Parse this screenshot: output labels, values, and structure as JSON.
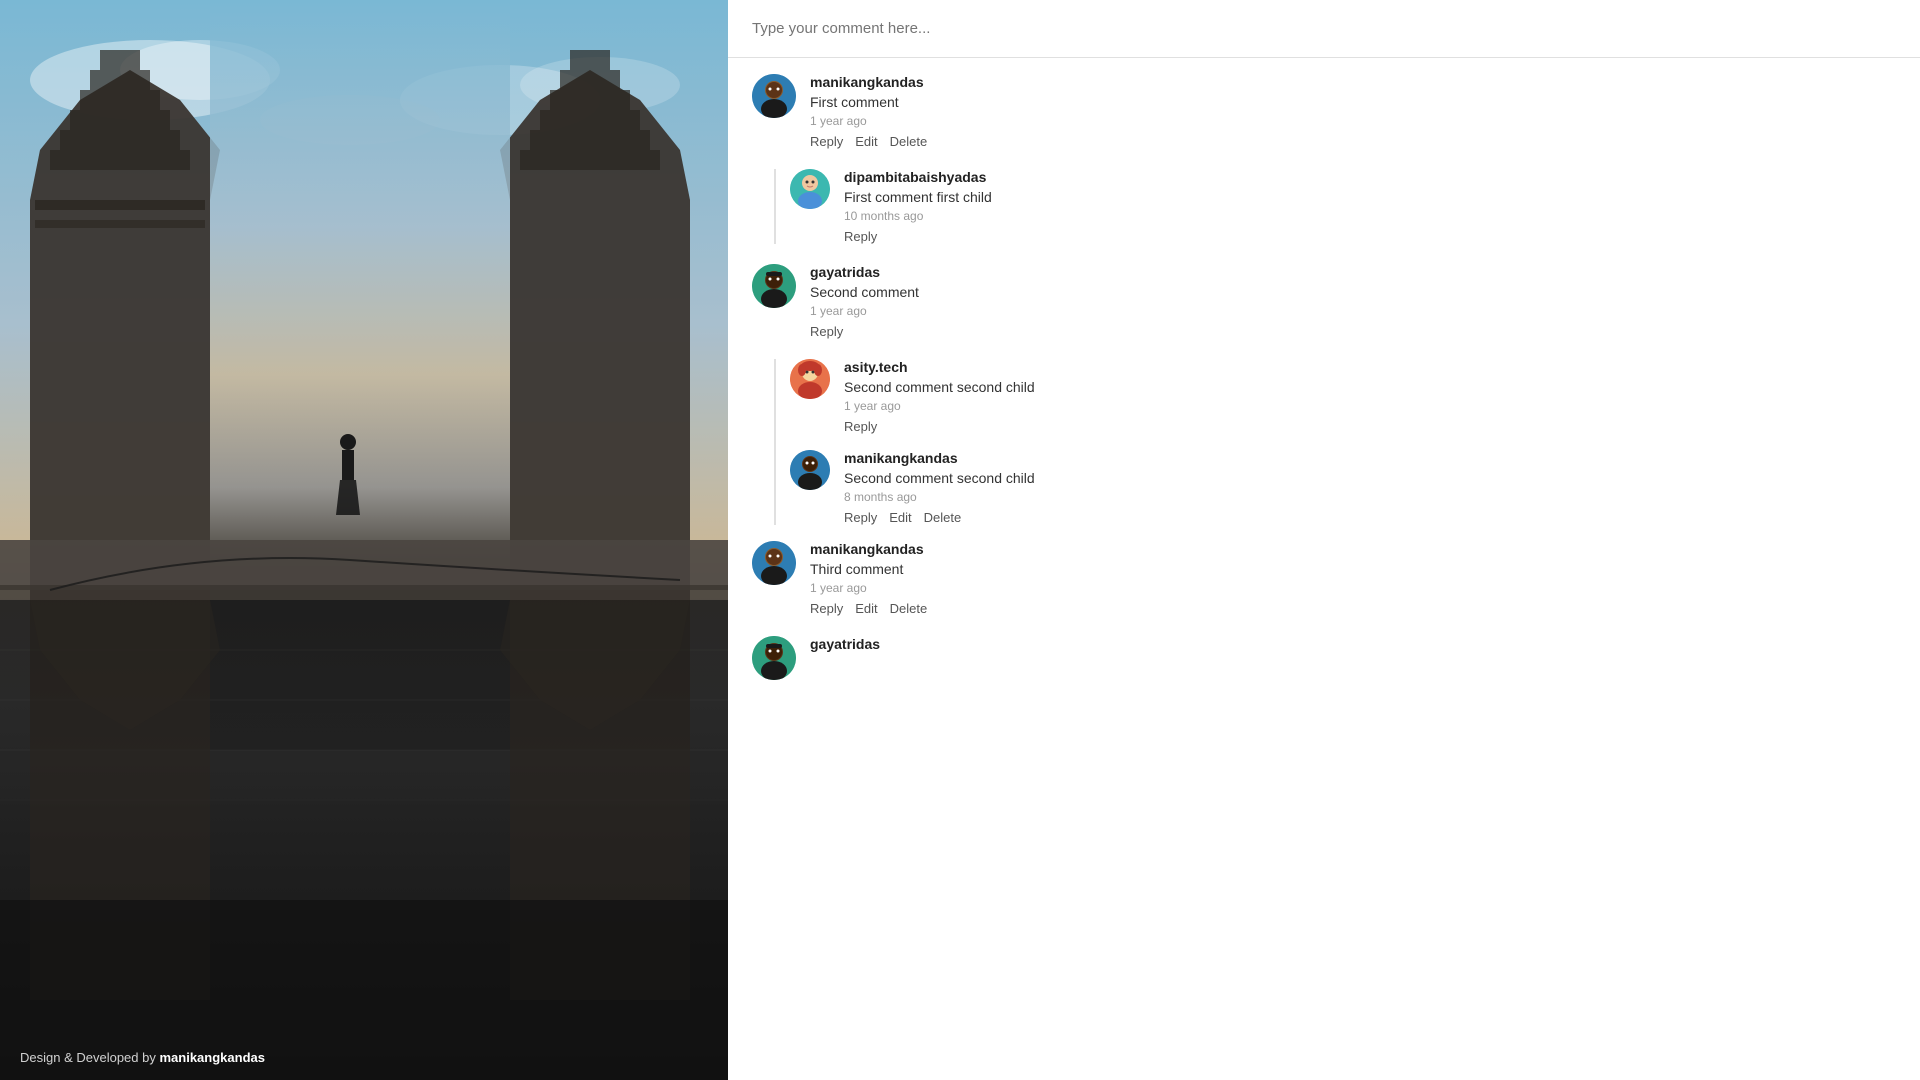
{
  "image": {
    "credit_prefix": "Design & Developed by",
    "credit_author": "manikangkandas"
  },
  "comments": {
    "input_placeholder": "Type your comment here...",
    "items": [
      {
        "id": "c1",
        "author": "manikangkandas",
        "text": "First comment",
        "time": "1 year ago",
        "avatar_type": "manikang",
        "avatar_emoji": "🧑🏿",
        "actions": [
          "Reply",
          "Edit",
          "Delete"
        ],
        "children": [
          {
            "id": "c1-1",
            "author": "dipambitabaishyadas",
            "text": "First comment first child",
            "time": "10 months ago",
            "avatar_type": "dipamb",
            "avatar_emoji": "👧",
            "actions": [
              "Reply"
            ]
          }
        ]
      },
      {
        "id": "c2",
        "author": "gayatridas",
        "text": "Second comment",
        "time": "1 year ago",
        "avatar_type": "gayatr",
        "avatar_emoji": "🧑🏿",
        "actions": [
          "Reply"
        ],
        "children": [
          {
            "id": "c2-1",
            "author": "asity.tech",
            "text": "Second comment second child",
            "time": "1 year ago",
            "avatar_type": "asity",
            "avatar_emoji": "👩‍🦰",
            "actions": [
              "Reply"
            ]
          },
          {
            "id": "c2-2",
            "author": "manikangkandas",
            "text": "Second comment second child",
            "time": "8 months ago",
            "avatar_type": "manikang",
            "avatar_emoji": "🧑🏿",
            "actions": [
              "Reply",
              "Edit",
              "Delete"
            ]
          }
        ]
      },
      {
        "id": "c3",
        "author": "manikangkandas",
        "text": "Third comment",
        "time": "1 year ago",
        "avatar_type": "manikang",
        "avatar_emoji": "🧑🏿",
        "actions": [
          "Reply",
          "Edit",
          "Delete"
        ],
        "children": []
      },
      {
        "id": "c4",
        "author": "gayatridas",
        "text": "",
        "time": "",
        "avatar_type": "gayatr",
        "avatar_emoji": "🧑🏿",
        "actions": [],
        "children": []
      }
    ]
  }
}
